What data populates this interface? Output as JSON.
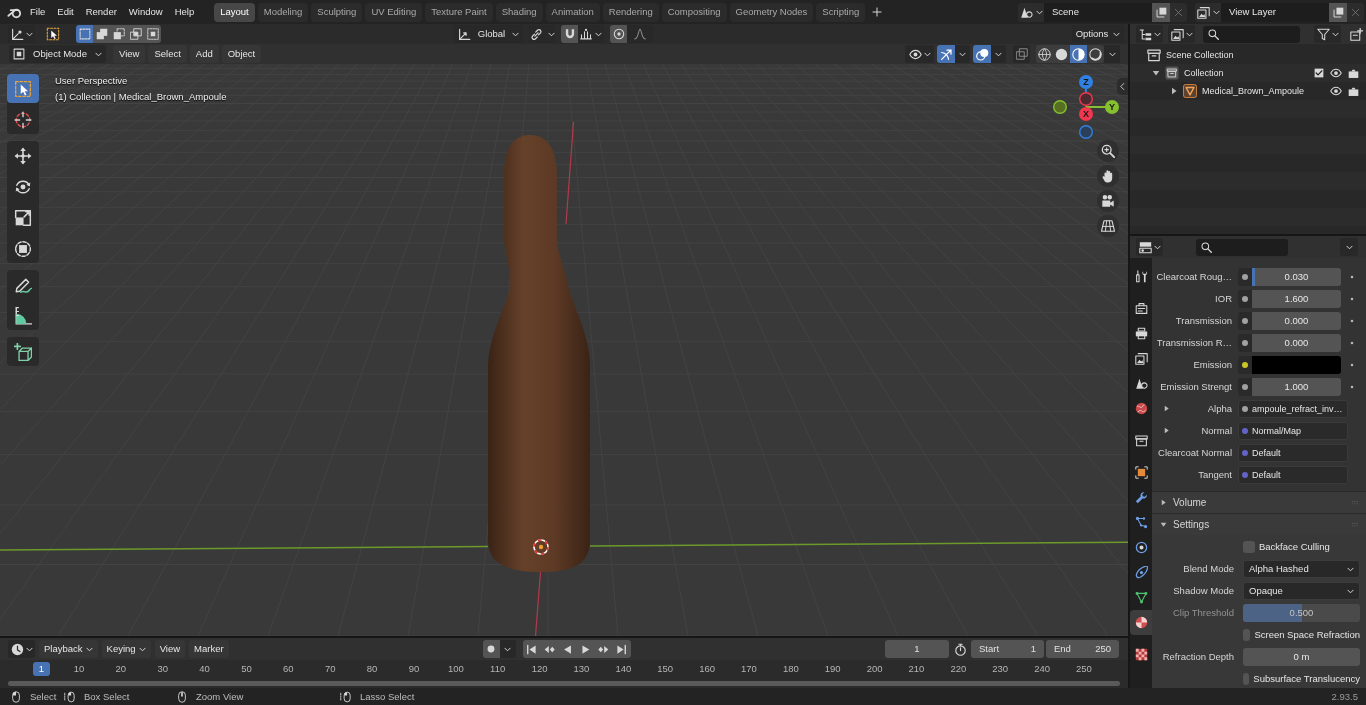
{
  "topbar": {
    "menus": [
      "File",
      "Edit",
      "Render",
      "Window",
      "Help"
    ],
    "workspaces": [
      {
        "label": "Layout",
        "selected": true
      },
      {
        "label": "Modeling",
        "selected": false
      },
      {
        "label": "Sculpting",
        "selected": false
      },
      {
        "label": "UV Editing",
        "selected": false
      },
      {
        "label": "Texture Paint",
        "selected": false
      },
      {
        "label": "Shading",
        "selected": false
      },
      {
        "label": "Animation",
        "selected": false
      },
      {
        "label": "Rendering",
        "selected": false
      },
      {
        "label": "Compositing",
        "selected": false
      },
      {
        "label": "Geometry Nodes",
        "selected": false
      },
      {
        "label": "Scripting",
        "selected": false
      }
    ],
    "scene": "Scene",
    "view_layer": "View Layer"
  },
  "tool_header": {
    "select_modes": [
      {
        "selected": true
      },
      {
        "selected": false
      },
      {
        "selected": false
      },
      {
        "selected": false
      },
      {
        "selected": false
      }
    ],
    "orientation": "Global",
    "options": "Options"
  },
  "viewport_header": {
    "mode": "Object Mode",
    "menus": [
      "View",
      "Select",
      "Add",
      "Object"
    ],
    "gizmos": {
      "on": true
    },
    "overlays": {
      "on": true
    },
    "xray": {
      "on": false
    },
    "shading": [
      {
        "selected": false
      },
      {
        "selected": false
      },
      {
        "selected": true
      },
      {
        "selected": false
      }
    ]
  },
  "viewport": {
    "view_name": "User Perspective",
    "object_info": "(1) Collection | Medical_Brown_Ampoule",
    "tools": [
      {
        "selected": true
      },
      {
        "selected": false
      },
      {
        "selected": false
      },
      {
        "selected": false
      },
      {
        "selected": false
      },
      {
        "selected": false
      },
      {
        "selected": false
      },
      {
        "selected": false
      },
      {
        "selected": false
      }
    ],
    "gizmo_axes": [
      {
        "label": "Z"
      },
      {
        "label": "Y"
      },
      {
        "label": "X"
      }
    ]
  },
  "outliner": {
    "root": {
      "kind": "scene_collection",
      "label": "Scene Collection",
      "children": [
        {
          "kind": "collection",
          "label": "Collection",
          "expanded": true,
          "checked": true,
          "visible": true,
          "renderable": true,
          "children": [
            {
              "kind": "object",
              "label": "Medical_Brown_Ampoule",
              "expanded": false,
              "visible": true,
              "renderable": true
            }
          ]
        }
      ]
    }
  },
  "properties": {
    "tabs": [
      {
        "selected": false
      },
      {
        "selected": false
      },
      {
        "selected": false
      },
      {
        "selected": false
      },
      {
        "selected": false
      },
      {
        "selected": false
      },
      {
        "selected": false
      },
      {
        "selected": false
      },
      {
        "selected": false
      },
      {
        "selected": false
      },
      {
        "selected": false
      },
      {
        "selected": false
      },
      {
        "selected": false
      },
      {
        "selected": true
      },
      {
        "selected": false
      }
    ],
    "inputs": [
      {
        "kind": "number",
        "label": "Clearcoat Roug…",
        "value": "0.030",
        "level": 0.03,
        "color": "#a1a1a1"
      },
      {
        "kind": "number",
        "label": "IOR",
        "value": "1.600",
        "color": "#a1a1a1"
      },
      {
        "kind": "number",
        "label": "Transmission",
        "value": "0.000",
        "color": "#a1a1a1"
      },
      {
        "kind": "number",
        "label": "Transmission R…",
        "value": "0.000",
        "color": "#a1a1a1"
      },
      {
        "kind": "color",
        "label": "Emission",
        "swatch": {
          "color": "#000000"
        },
        "color": "#c7c729"
      },
      {
        "kind": "number",
        "label": "Emission Strengt",
        "value": "1.000",
        "color": "#a1a1a1"
      },
      {
        "kind": "link",
        "label": "Alpha",
        "value": "ampoule_refract_inv…",
        "expanded": false,
        "color": "#a1a1a1"
      },
      {
        "kind": "link",
        "label": "Normal",
        "value": "Normal/Map",
        "expanded": false,
        "color": "#6363c7"
      },
      {
        "kind": "default",
        "label": "Clearcoat Normal",
        "value": "Default",
        "color": "#6363c7"
      },
      {
        "kind": "default",
        "label": "Tangent",
        "value": "Default",
        "color": "#6363c7"
      }
    ],
    "panels": [
      {
        "label": "Volume",
        "expanded": false
      },
      {
        "label": "Settings",
        "expanded": true,
        "rows": [
          {
            "kind": "checkbox",
            "label": "Backface Culling",
            "checked": false,
            "disabled": false
          },
          {
            "kind": "dropdown",
            "label": "Blend Mode",
            "value": "Alpha Hashed",
            "disabled": false
          },
          {
            "kind": "dropdown",
            "label": "Shadow Mode",
            "value": "Opaque",
            "disabled": false
          },
          {
            "kind": "slider",
            "label": "Clip Threshold",
            "value": "0.500",
            "level": 0.5,
            "disabled": true
          },
          {
            "kind": "checkbox",
            "label": "Screen Space Refraction",
            "checked": false,
            "disabled": false
          },
          {
            "kind": "number",
            "label": "Refraction Depth",
            "value": "0 m",
            "disabled": false
          },
          {
            "kind": "checkbox",
            "label": "Subsurface Translucency",
            "checked": false,
            "disabled": false
          }
        ]
      }
    ]
  },
  "timeline": {
    "menus": [
      {
        "label": "Playback",
        "dropdown": true
      },
      {
        "label": "Keying",
        "dropdown": true
      },
      {
        "label": "View",
        "dropdown": false
      },
      {
        "label": "Marker",
        "dropdown": false
      }
    ],
    "auto_keying": {
      "on": false
    },
    "current_frame": "1",
    "start": {
      "label": "Start",
      "value": "1"
    },
    "end": {
      "label": "End",
      "value": "250"
    },
    "playhead": "1",
    "ticks": [
      "10",
      "20",
      "30",
      "40",
      "50",
      "60",
      "70",
      "80",
      "90",
      "100",
      "110",
      "120",
      "130",
      "140",
      "150",
      "160",
      "170",
      "180",
      "190",
      "200",
      "210",
      "220",
      "230",
      "240",
      "250"
    ]
  },
  "status_bar": {
    "hints": [
      "Select",
      "Box Select",
      "Zoom View",
      "Lasso Select"
    ],
    "version": "2.93.5"
  }
}
